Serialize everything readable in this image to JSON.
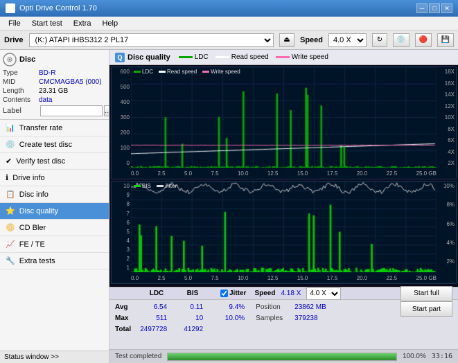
{
  "window": {
    "title": "Opti Drive Control 1.70",
    "min_btn": "─",
    "max_btn": "□",
    "close_btn": "✕"
  },
  "menu": {
    "items": [
      "File",
      "Start test",
      "Extra",
      "Help"
    ]
  },
  "drive_bar": {
    "label": "Drive",
    "drive_value": "(K:)  ATAPI iHBS312  2 PL17",
    "speed_label": "Speed",
    "speed_value": "4.0 X"
  },
  "disc": {
    "title": "Disc",
    "type_label": "Type",
    "type_value": "BD-R",
    "mid_label": "MID",
    "mid_value": "CMCMAGBA5 (000)",
    "length_label": "Length",
    "length_value": "23.31 GB",
    "contents_label": "Contents",
    "contents_value": "data",
    "label_label": "Label"
  },
  "nav": {
    "items": [
      {
        "id": "transfer-rate",
        "label": "Transfer rate",
        "icon": "📊"
      },
      {
        "id": "create-test-disc",
        "label": "Create test disc",
        "icon": "💿"
      },
      {
        "id": "verify-test-disc",
        "label": "Verify test disc",
        "icon": "✔"
      },
      {
        "id": "drive-info",
        "label": "Drive info",
        "icon": "ℹ"
      },
      {
        "id": "disc-info",
        "label": "Disc info",
        "icon": "📋"
      },
      {
        "id": "disc-quality",
        "label": "Disc quality",
        "icon": "⭐",
        "active": true
      },
      {
        "id": "cd-bler",
        "label": "CD Bler",
        "icon": "📀"
      },
      {
        "id": "fe-te",
        "label": "FE / TE",
        "icon": "📈"
      },
      {
        "id": "extra-tests",
        "label": "Extra tests",
        "icon": "🔧"
      }
    ]
  },
  "status_window": {
    "label": "Status window >>"
  },
  "chart_header": {
    "title": "Disc quality",
    "legend": {
      "ldc_label": "LDC",
      "read_label": "Read speed",
      "write_label": "Write speed"
    }
  },
  "chart1": {
    "y_labels": [
      "600",
      "500",
      "400",
      "300",
      "200",
      "100",
      "0"
    ],
    "y_right_labels": [
      "18X",
      "16X",
      "14X",
      "12X",
      "10X",
      "8X",
      "6X",
      "4X",
      "2X"
    ],
    "x_labels": [
      "0.0",
      "2.5",
      "5.0",
      "7.5",
      "10.0",
      "12.5",
      "15.0",
      "17.5",
      "20.0",
      "22.5",
      "25.0 GB"
    ],
    "legend_items": [
      "LDC",
      "Read speed",
      "Write speed"
    ]
  },
  "chart2": {
    "title_label": "BIS",
    "jitter_label": "Jitter",
    "y_labels": [
      "10",
      "9",
      "8",
      "7",
      "6",
      "5",
      "4",
      "3",
      "2",
      "1"
    ],
    "y_right_labels": [
      "10%",
      "8%",
      "6%",
      "4%",
      "2%"
    ],
    "x_labels": [
      "0.0",
      "2.5",
      "5.0",
      "7.5",
      "10.0",
      "12.5",
      "15.0",
      "17.5",
      "20.0",
      "22.5",
      "25.0 GB"
    ]
  },
  "stats": {
    "col_headers": [
      "",
      "LDC",
      "BIS",
      "",
      "Jitter",
      "Speed"
    ],
    "avg_label": "Avg",
    "max_label": "Max",
    "total_label": "Total",
    "ldc_avg": "6.54",
    "ldc_max": "511",
    "ldc_total": "2497728",
    "bis_avg": "0.11",
    "bis_max": "10",
    "bis_total": "41292",
    "jitter_avg": "9.4%",
    "jitter_max": "10.0%",
    "speed_val": "4.18 X",
    "speed_label": "Speed",
    "speed_dropdown": "4.0 X",
    "position_label": "Position",
    "position_val": "23862 MB",
    "samples_label": "Samples",
    "samples_val": "379238",
    "start_full_label": "Start full",
    "start_part_label": "Start part"
  },
  "bottom_status": {
    "status_text": "Test completed",
    "progress_pct": "100.0%",
    "time": "33:16"
  },
  "colors": {
    "accent_blue": "#4a90d9",
    "ldc_color": "#00aa00",
    "read_speed_color": "#ffffff",
    "write_speed_color": "#ff69b4",
    "bis_color": "#00dd00",
    "jitter_color": "#dddddd",
    "grid_line": "#1a3a5a",
    "chart_bg": "#001428"
  }
}
